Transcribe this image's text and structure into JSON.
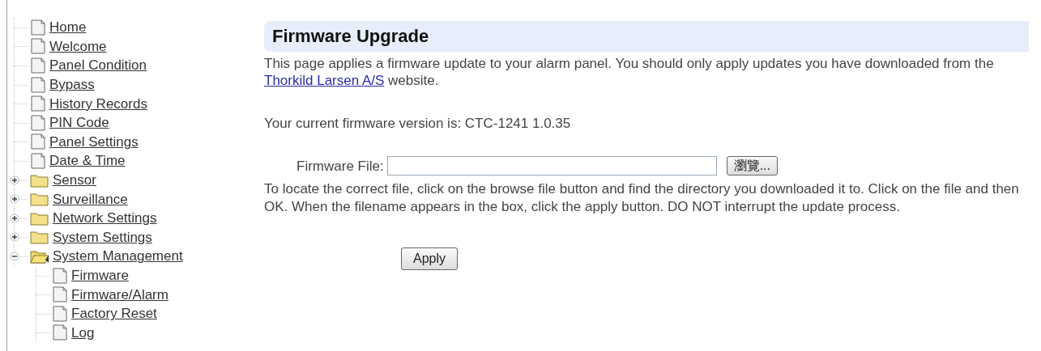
{
  "tree": [
    {
      "kind": "page",
      "label": "Home"
    },
    {
      "kind": "page",
      "label": "Welcome"
    },
    {
      "kind": "page",
      "label": "Panel Condition"
    },
    {
      "kind": "page",
      "label": "Bypass"
    },
    {
      "kind": "page",
      "label": "History Records"
    },
    {
      "kind": "page",
      "label": "PIN Code"
    },
    {
      "kind": "page",
      "label": "Panel Settings"
    },
    {
      "kind": "page",
      "label": "Date & Time"
    },
    {
      "kind": "folder",
      "label": "Sensor",
      "expanded": false
    },
    {
      "kind": "folder",
      "label": "Surveillance",
      "expanded": false
    },
    {
      "kind": "folder",
      "label": "Network Settings",
      "expanded": false
    },
    {
      "kind": "folder",
      "label": "System Settings",
      "expanded": false
    },
    {
      "kind": "folder",
      "label": "System Management",
      "expanded": true,
      "children": [
        {
          "kind": "page",
          "label": "Firmware"
        },
        {
          "kind": "page",
          "label": "Firmware/Alarm"
        },
        {
          "kind": "page",
          "label": "Factory Reset"
        },
        {
          "kind": "page",
          "label": "Log"
        }
      ]
    }
  ],
  "content": {
    "title": "Firmware Upgrade",
    "intro": {
      "before": "This page applies a firmware update to your alarm panel. You should only apply updates you have downloaded from the ",
      "link": "Thorkild Larsen A/S",
      "after": " website."
    },
    "version": "Your current firmware version is: CTC-1241 1.0.35",
    "file_label": "Firmware File:",
    "browse_button": "瀏覽...",
    "instructions": "To locate the correct file, click on the browse file button and find the directory you downloaded it to. Click on the file and then OK. When the filename appears in the box, click the apply button. DO NOT interrupt the update process.",
    "apply_button": "Apply"
  }
}
